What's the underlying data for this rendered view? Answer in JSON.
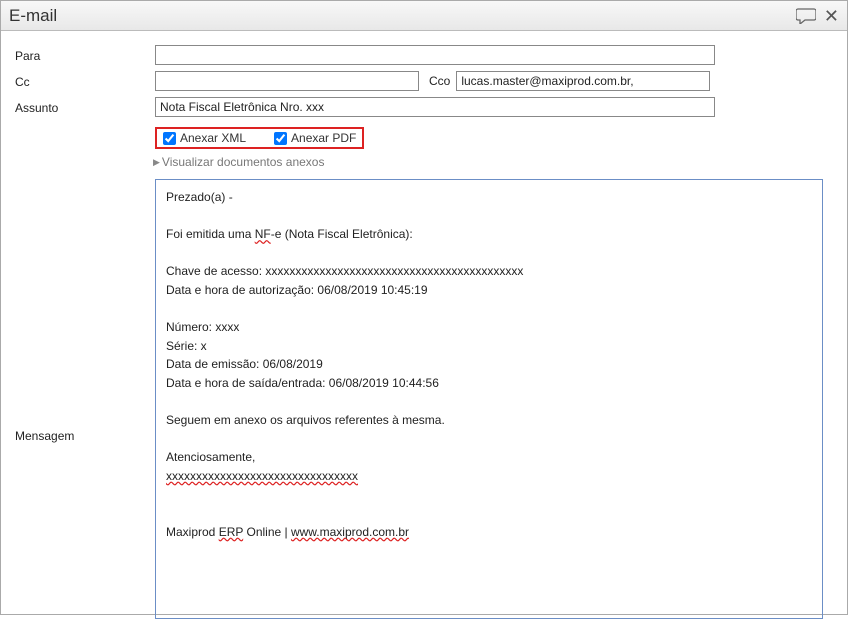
{
  "window": {
    "title": "E-mail"
  },
  "labels": {
    "para": "Para",
    "cc": "Cc",
    "cco": "Cco",
    "assunto": "Assunto",
    "mensagem": "Mensagem",
    "anexar_xml": "Anexar XML",
    "anexar_pdf": "Anexar PDF",
    "visualizar_anexos": "Visualizar documentos anexos"
  },
  "fields": {
    "para": "",
    "cc": "",
    "cco": "lucas.master@maxiprod.com.br,",
    "assunto": "Nota Fiscal Eletrônica Nro. xxx",
    "anexar_xml": true,
    "anexar_pdf": true
  },
  "message": {
    "greeting": "Prezado(a)  -",
    "line_intro_a": "Foi emitida uma  ",
    "line_intro_b": "NF",
    "line_intro_c": "-e (Nota Fiscal Eletrônica):",
    "chave_label": "Chave de acesso: ",
    "chave_value": "xxxxxxxxxxxxxxxxxxxxxxxxxxxxxxxxxxxxxxxxxxx",
    "auth_line": "Data e hora de autorização: 06/08/2019 10:45:19",
    "numero": "Número: xxxx",
    "serie": "Série: x",
    "emissao": "Data de emissão: 06/08/2019",
    "saida": "Data e hora de saída/entrada: 06/08/2019 10:44:56",
    "seguem": "Seguem em anexo os arquivos referentes à mesma.",
    "atenciosamente": "Atenciosamente,",
    "xline": "xxxxxxxxxxxxxxxxxxxxxxxxxxxxxxxx",
    "footer_a": "Maxiprod ",
    "footer_b": "ERP",
    "footer_c": " Online | ",
    "footer_d": "www.maxiprod.com.br"
  }
}
